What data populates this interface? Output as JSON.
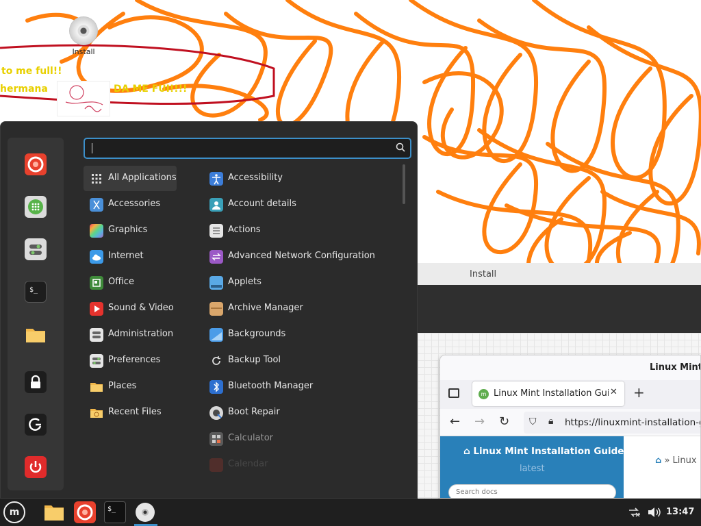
{
  "desktop": {
    "icons": [
      {
        "label": "Install",
        "icon": "cd-disc-icon"
      }
    ],
    "scribble_color": "#ff7f0e",
    "wallpaper_text": [
      "to me full!!",
      "hermana",
      "DA ME FUI!!!!"
    ]
  },
  "install_window": {
    "title": "Install"
  },
  "browser": {
    "window_title": "Linux Mint In",
    "tab_title": "Linux Mint Installation Guide",
    "url": "https://linuxmint-installation-gu",
    "doc_title": "Linux Mint Installation Guide",
    "doc_version": "latest",
    "search_placeholder": "Search docs",
    "breadcrumb": "» Linux"
  },
  "menu": {
    "search_value": "",
    "favorites": [
      {
        "name": "firefox",
        "icon": "firefox-icon"
      },
      {
        "name": "software-manager",
        "icon": "software-manager-icon"
      },
      {
        "name": "system-settings",
        "icon": "settings-icon"
      },
      {
        "name": "terminal",
        "icon": "terminal-icon"
      },
      {
        "name": "files",
        "icon": "folder-icon"
      },
      {
        "name": "lock-screen",
        "icon": "lock-icon"
      },
      {
        "name": "logout",
        "icon": "logout-icon"
      },
      {
        "name": "quit",
        "icon": "power-icon"
      }
    ],
    "categories": [
      {
        "label": "All Applications",
        "icon": "grid-icon"
      },
      {
        "label": "Accessories",
        "icon": "scissors-icon"
      },
      {
        "label": "Graphics",
        "icon": "graphics-icon"
      },
      {
        "label": "Internet",
        "icon": "cloud-icon"
      },
      {
        "label": "Office",
        "icon": "office-icon"
      },
      {
        "label": "Sound & Video",
        "icon": "play-icon"
      },
      {
        "label": "Administration",
        "icon": "administration-icon"
      },
      {
        "label": "Preferences",
        "icon": "preferences-icon"
      },
      {
        "label": "Places",
        "icon": "folder-icon"
      },
      {
        "label": "Recent Files",
        "icon": "recent-folder-icon"
      }
    ],
    "apps": [
      {
        "label": "Accessibility",
        "icon": "accessibility-icon"
      },
      {
        "label": "Account details",
        "icon": "account-icon"
      },
      {
        "label": "Actions",
        "icon": "actions-icon"
      },
      {
        "label": "Advanced Network Configuration",
        "icon": "network-icon"
      },
      {
        "label": "Applets",
        "icon": "applets-icon"
      },
      {
        "label": "Archive Manager",
        "icon": "archive-icon"
      },
      {
        "label": "Backgrounds",
        "icon": "backgrounds-icon"
      },
      {
        "label": "Backup Tool",
        "icon": "backup-icon"
      },
      {
        "label": "Bluetooth Manager",
        "icon": "bluetooth-icon"
      },
      {
        "label": "Boot Repair",
        "icon": "boot-repair-icon"
      },
      {
        "label": "Calculator",
        "icon": "calculator-icon"
      },
      {
        "label": "Calendar",
        "icon": "calendar-icon"
      }
    ]
  },
  "taskbar": {
    "items": [
      {
        "name": "menu",
        "icon": "mint-logo-icon"
      },
      {
        "name": "files",
        "icon": "folder-icon"
      },
      {
        "name": "firefox",
        "icon": "firefox-icon"
      },
      {
        "name": "terminal",
        "icon": "terminal-icon"
      },
      {
        "name": "install",
        "icon": "cd-disc-icon"
      }
    ],
    "clock": "13:47",
    "accent": "#3c8fc9"
  }
}
